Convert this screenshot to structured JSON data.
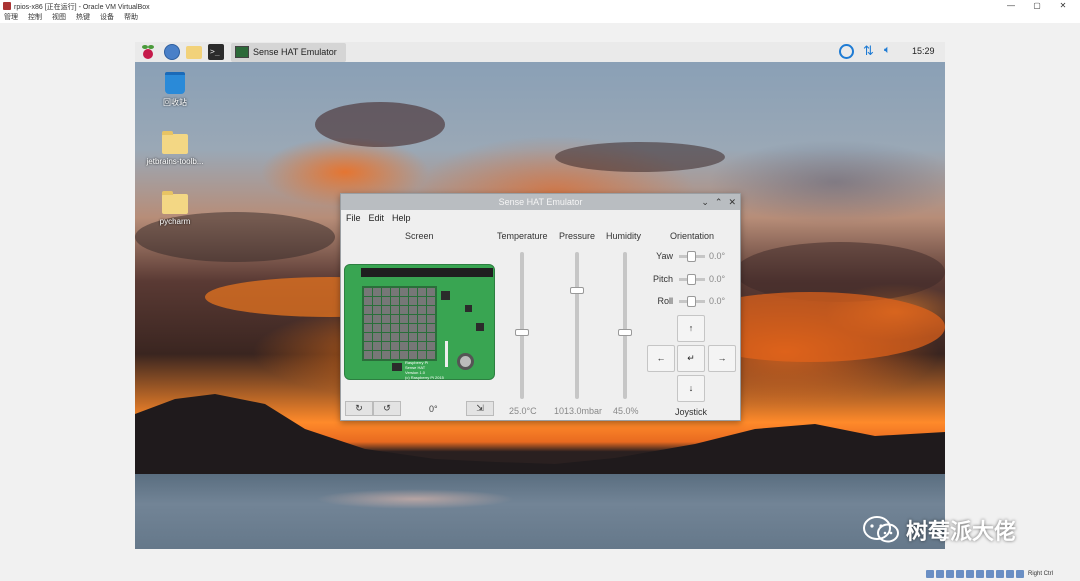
{
  "host": {
    "title": "rpios-x86 [正在运行] - Oracle VM VirtualBox",
    "menu": [
      "管理",
      "控制",
      "视图",
      "热键",
      "设备",
      "帮助"
    ],
    "controls": [
      "—",
      "▢",
      "✕"
    ],
    "host_key": "Right Ctrl"
  },
  "taskbar": {
    "terminal_glyph": ">_",
    "task_label": "Sense HAT Emulator",
    "clock": "15:29"
  },
  "desktop": {
    "icons": [
      {
        "label": "回收站",
        "icon": "trash-icon"
      },
      {
        "label": "jetbrains-toolb...",
        "icon": "folder-icon"
      },
      {
        "label": "pycharm",
        "icon": "folder-icon"
      }
    ]
  },
  "window": {
    "title": "Sense HAT Emulator",
    "controls": [
      "⌄",
      "⌃",
      "✕"
    ],
    "menu": [
      "File",
      "Edit",
      "Help"
    ],
    "headers": {
      "screen": "Screen",
      "temperature": "Temperature",
      "pressure": "Pressure",
      "humidity": "Humidity",
      "orientation": "Orientation"
    },
    "board_text": "Raspberry Pi\nSense HAT\nVersion 1.0\n(c) Raspberry Pi 2015",
    "screen_controls": {
      "rotate_cw": "↻",
      "rotate_ccw": "↺",
      "rotation_value": "0°",
      "flip": "⇲"
    },
    "sensors": {
      "temperature": {
        "value": "25.0°C",
        "level": 0.45
      },
      "pressure": {
        "value": "1013.0mbar",
        "level": 0.75
      },
      "humidity": {
        "value": "45.0%",
        "level": 0.45
      }
    },
    "orientation": {
      "yaw": {
        "label": "Yaw",
        "value": "0.0°"
      },
      "pitch": {
        "label": "Pitch",
        "value": "0.0°"
      },
      "roll": {
        "label": "Roll",
        "value": "0.0°"
      }
    },
    "joystick": {
      "up": "↑",
      "left": "←",
      "enter": "↵",
      "right": "→",
      "down": "↓",
      "label": "Joystick"
    }
  },
  "watermark": "树莓派大佬",
  "colors": {
    "accent": "#1e7bd4",
    "board_green": "#39a552",
    "led_off": "#777777"
  }
}
